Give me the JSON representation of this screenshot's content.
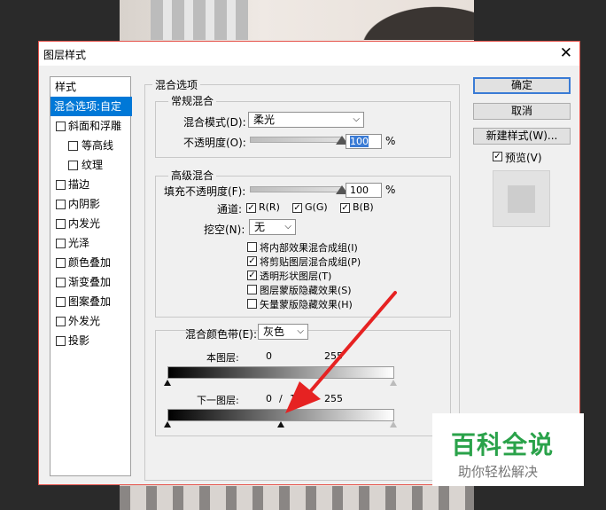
{
  "dialog": {
    "title": "图层样式",
    "close_glyph": "✕"
  },
  "sidebar": {
    "header": "样式",
    "items": [
      {
        "label": "混合选项:自定",
        "selected": true
      },
      {
        "label": "斜面和浮雕",
        "checked": false
      },
      {
        "label": "等高线",
        "checked": false
      },
      {
        "label": "纹理",
        "checked": false
      },
      {
        "label": "描边",
        "checked": false
      },
      {
        "label": "内阴影",
        "checked": false
      },
      {
        "label": "内发光",
        "checked": false
      },
      {
        "label": "光泽",
        "checked": false
      },
      {
        "label": "颜色叠加",
        "checked": false
      },
      {
        "label": "渐变叠加",
        "checked": false
      },
      {
        "label": "图案叠加",
        "checked": false
      },
      {
        "label": "外发光",
        "checked": false
      },
      {
        "label": "投影",
        "checked": false
      }
    ]
  },
  "blend_options": {
    "title": "混合选项",
    "general": {
      "title": "常规混合",
      "mode_label": "混合模式(D):",
      "mode_value": "柔光",
      "opacity_label": "不透明度(O):",
      "opacity_value": "100",
      "opacity_percent": 100,
      "unit": "%"
    },
    "advanced": {
      "title": "高级混合",
      "fill_label": "填充不透明度(F):",
      "fill_value": "100",
      "fill_percent": 100,
      "unit": "%",
      "channels_label": "通道:",
      "channels": [
        {
          "label": "R(R)",
          "checked": true
        },
        {
          "label": "G(G)",
          "checked": true
        },
        {
          "label": "B(B)",
          "checked": true
        }
      ],
      "knockout_label": "挖空(N):",
      "knockout_value": "无",
      "options": [
        {
          "label": "将内部效果混合成组(I)",
          "checked": false
        },
        {
          "label": "将剪贴图层混合成组(P)",
          "checked": true
        },
        {
          "label": "透明形状图层(T)",
          "checked": true
        },
        {
          "label": "图层蒙版隐藏效果(S)",
          "checked": false
        },
        {
          "label": "矢量蒙版隐藏效果(H)",
          "checked": false
        }
      ]
    },
    "blend_if": {
      "label": "混合颜色带(E):",
      "value": "灰色",
      "this_layer_label": "本图层:",
      "this_layer_low": "0",
      "this_layer_high": "255",
      "below_layer_label": "下一图层:",
      "below_layer_low": "0",
      "below_layer_sep": "/",
      "below_layer_mid": "1",
      "below_layer_high": "255"
    }
  },
  "buttons": {
    "ok": "确定",
    "cancel": "取消",
    "new_style": "新建样式(W)...",
    "preview_label": "预览(V)",
    "preview_checked": true
  },
  "watermark": {
    "title": "百科全说",
    "subtitle": "助你轻松解决"
  },
  "colors": {
    "selection": "#0078d7",
    "arrow": "#e62222",
    "watermark_green": "#2aa24a"
  }
}
